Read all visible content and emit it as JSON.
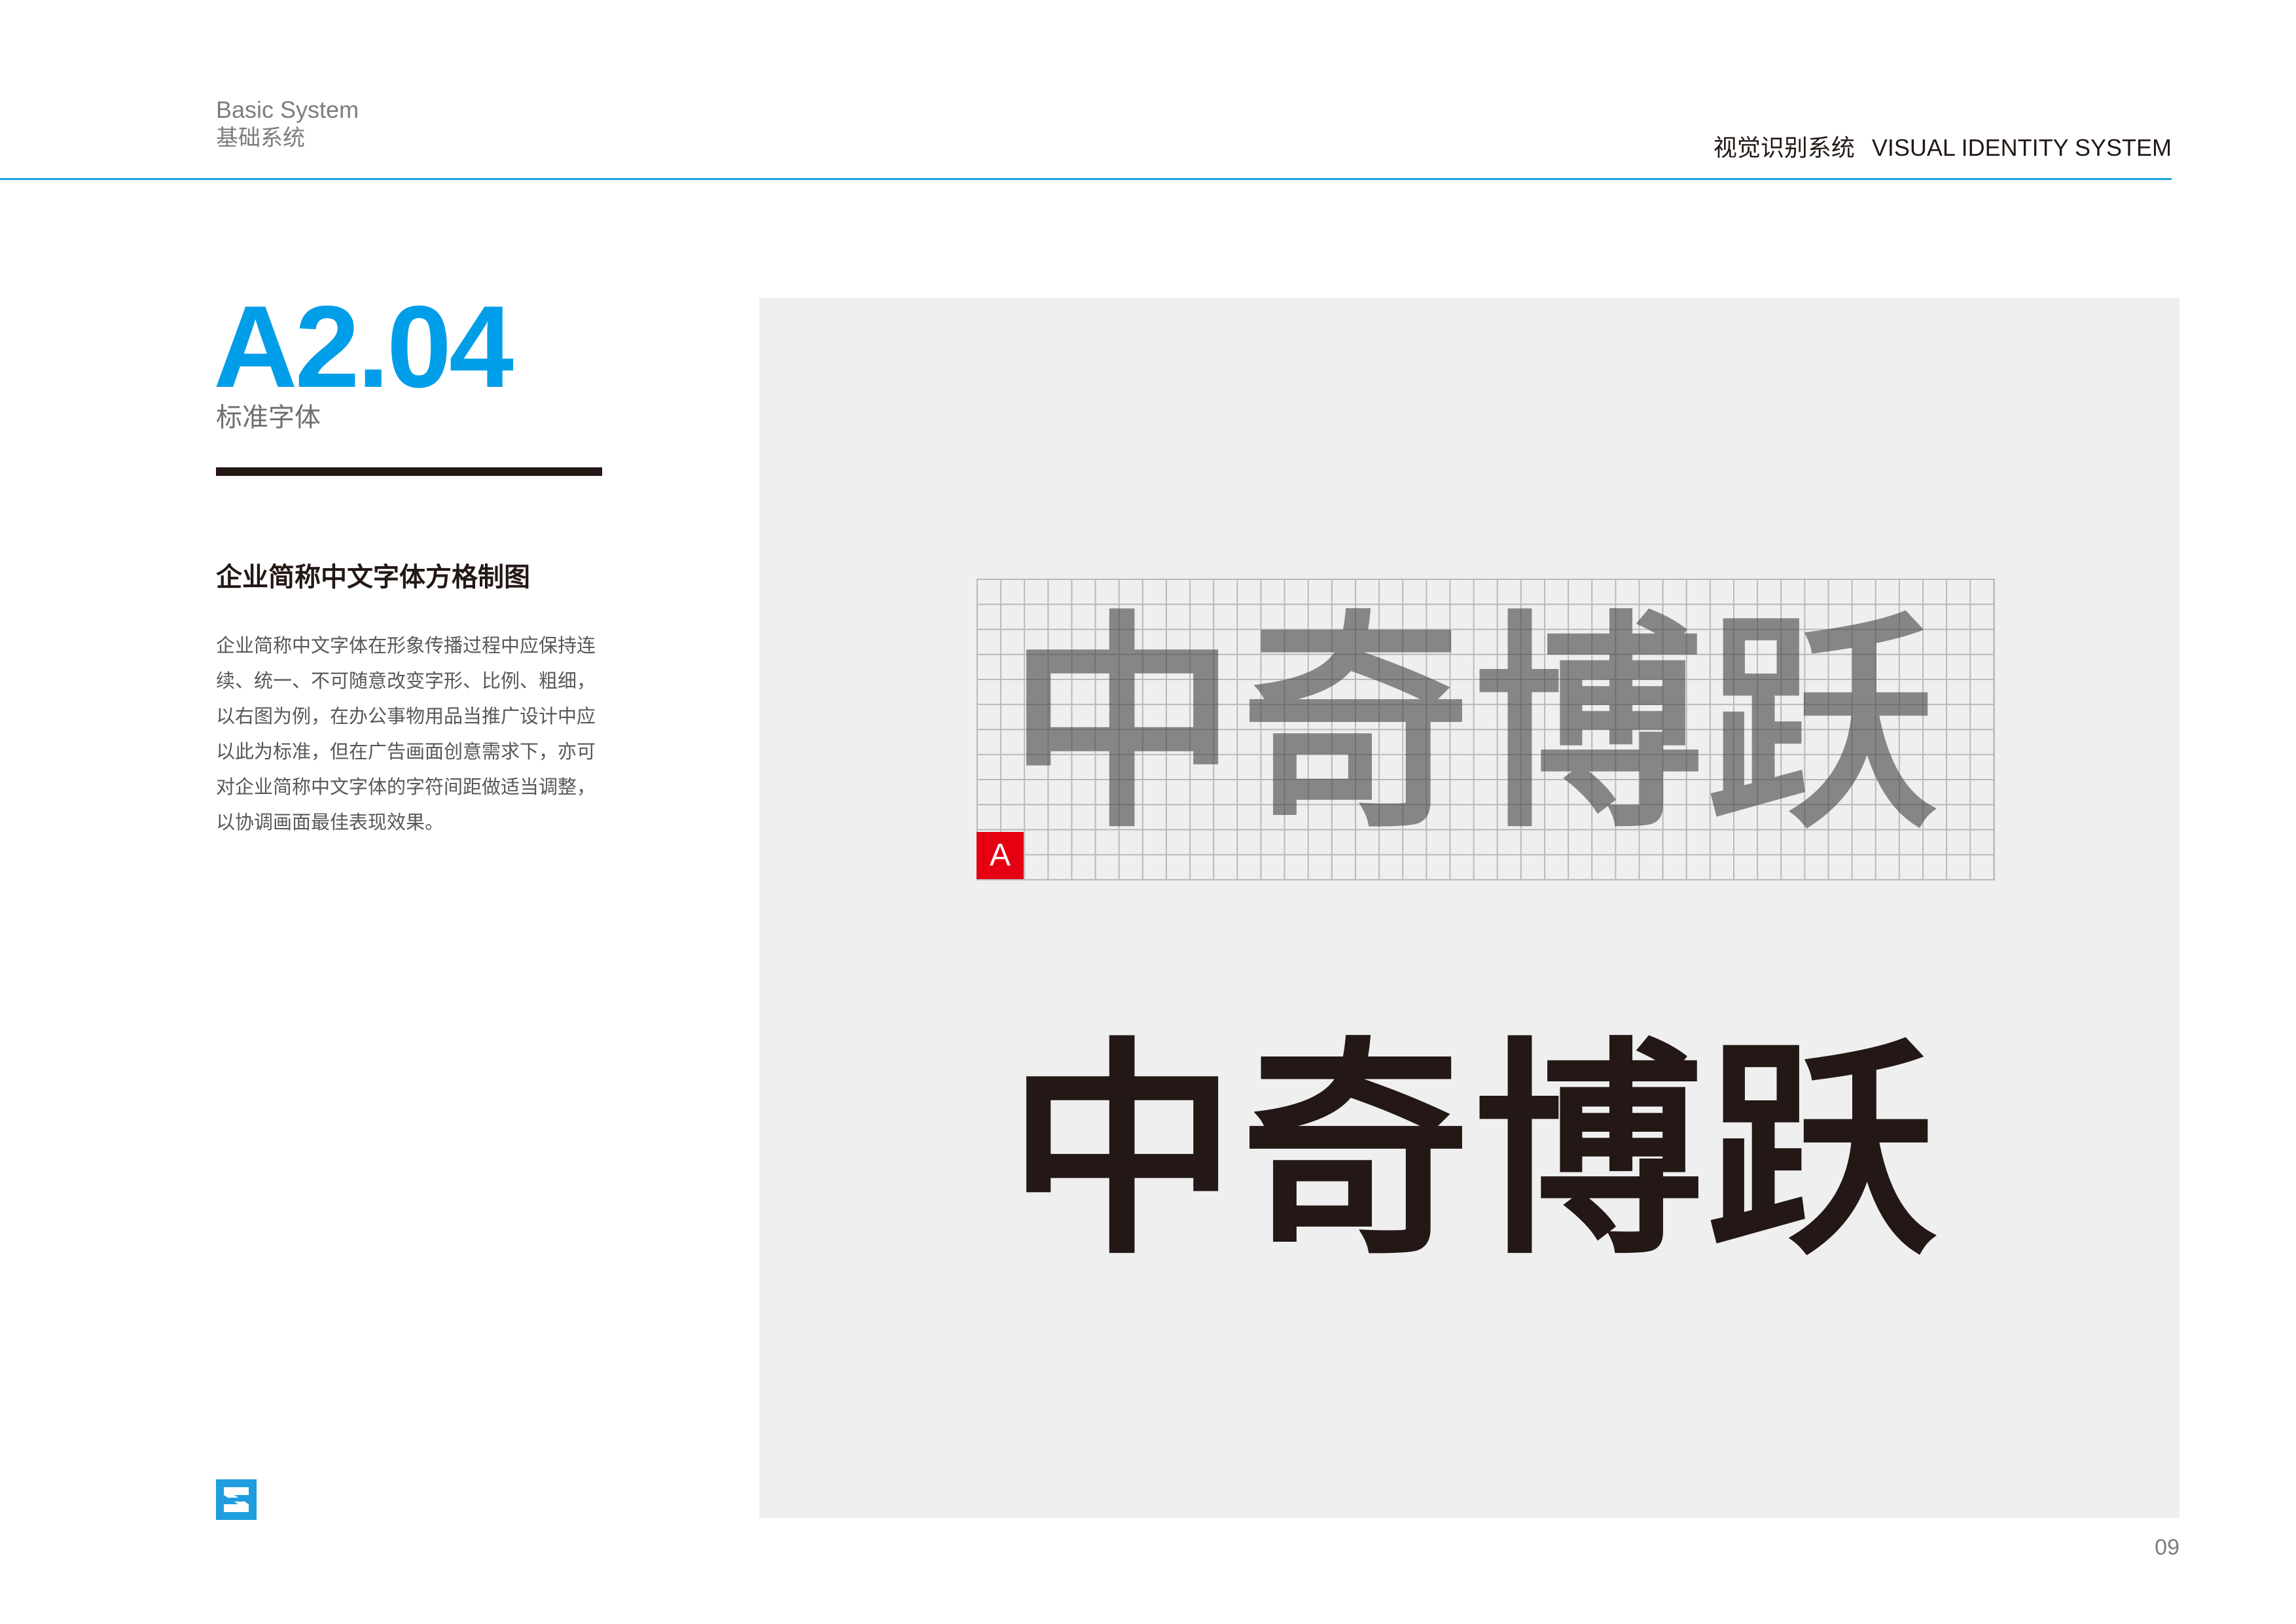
{
  "header": {
    "section_en": "Basic System",
    "section_cn": "基础系统",
    "system_cn": "视觉识别系统",
    "system_en": "VISUAL IDENTITY SYSTEM"
  },
  "section": {
    "code": "A2.04",
    "name": "标准字体"
  },
  "description": {
    "heading": "企业简称中文字体方格制图",
    "lines": [
      "企业简称中文字体在形象传播过程中应保持连",
      "续、统一、不可随意改变字形、比例、粗细，",
      "以右图为例，在办公事物用品当推广设计中应",
      "以此为标准，但在广告画面创意需求下，亦可",
      "对企业简称中文字体的字符间距做适当调整，",
      "以协调画面最佳表现效果。"
    ]
  },
  "artwork": {
    "wordmark": "中奇博跃",
    "grid_marker": "A",
    "colors": {
      "panel": "#efefef",
      "grid_line": "#b9b9b9",
      "marker": "#e50012",
      "wordmark": "#231815",
      "accent": "#009ee8"
    }
  },
  "footer": {
    "logo_icon": "brand-logo-icon",
    "page_number": "09"
  }
}
